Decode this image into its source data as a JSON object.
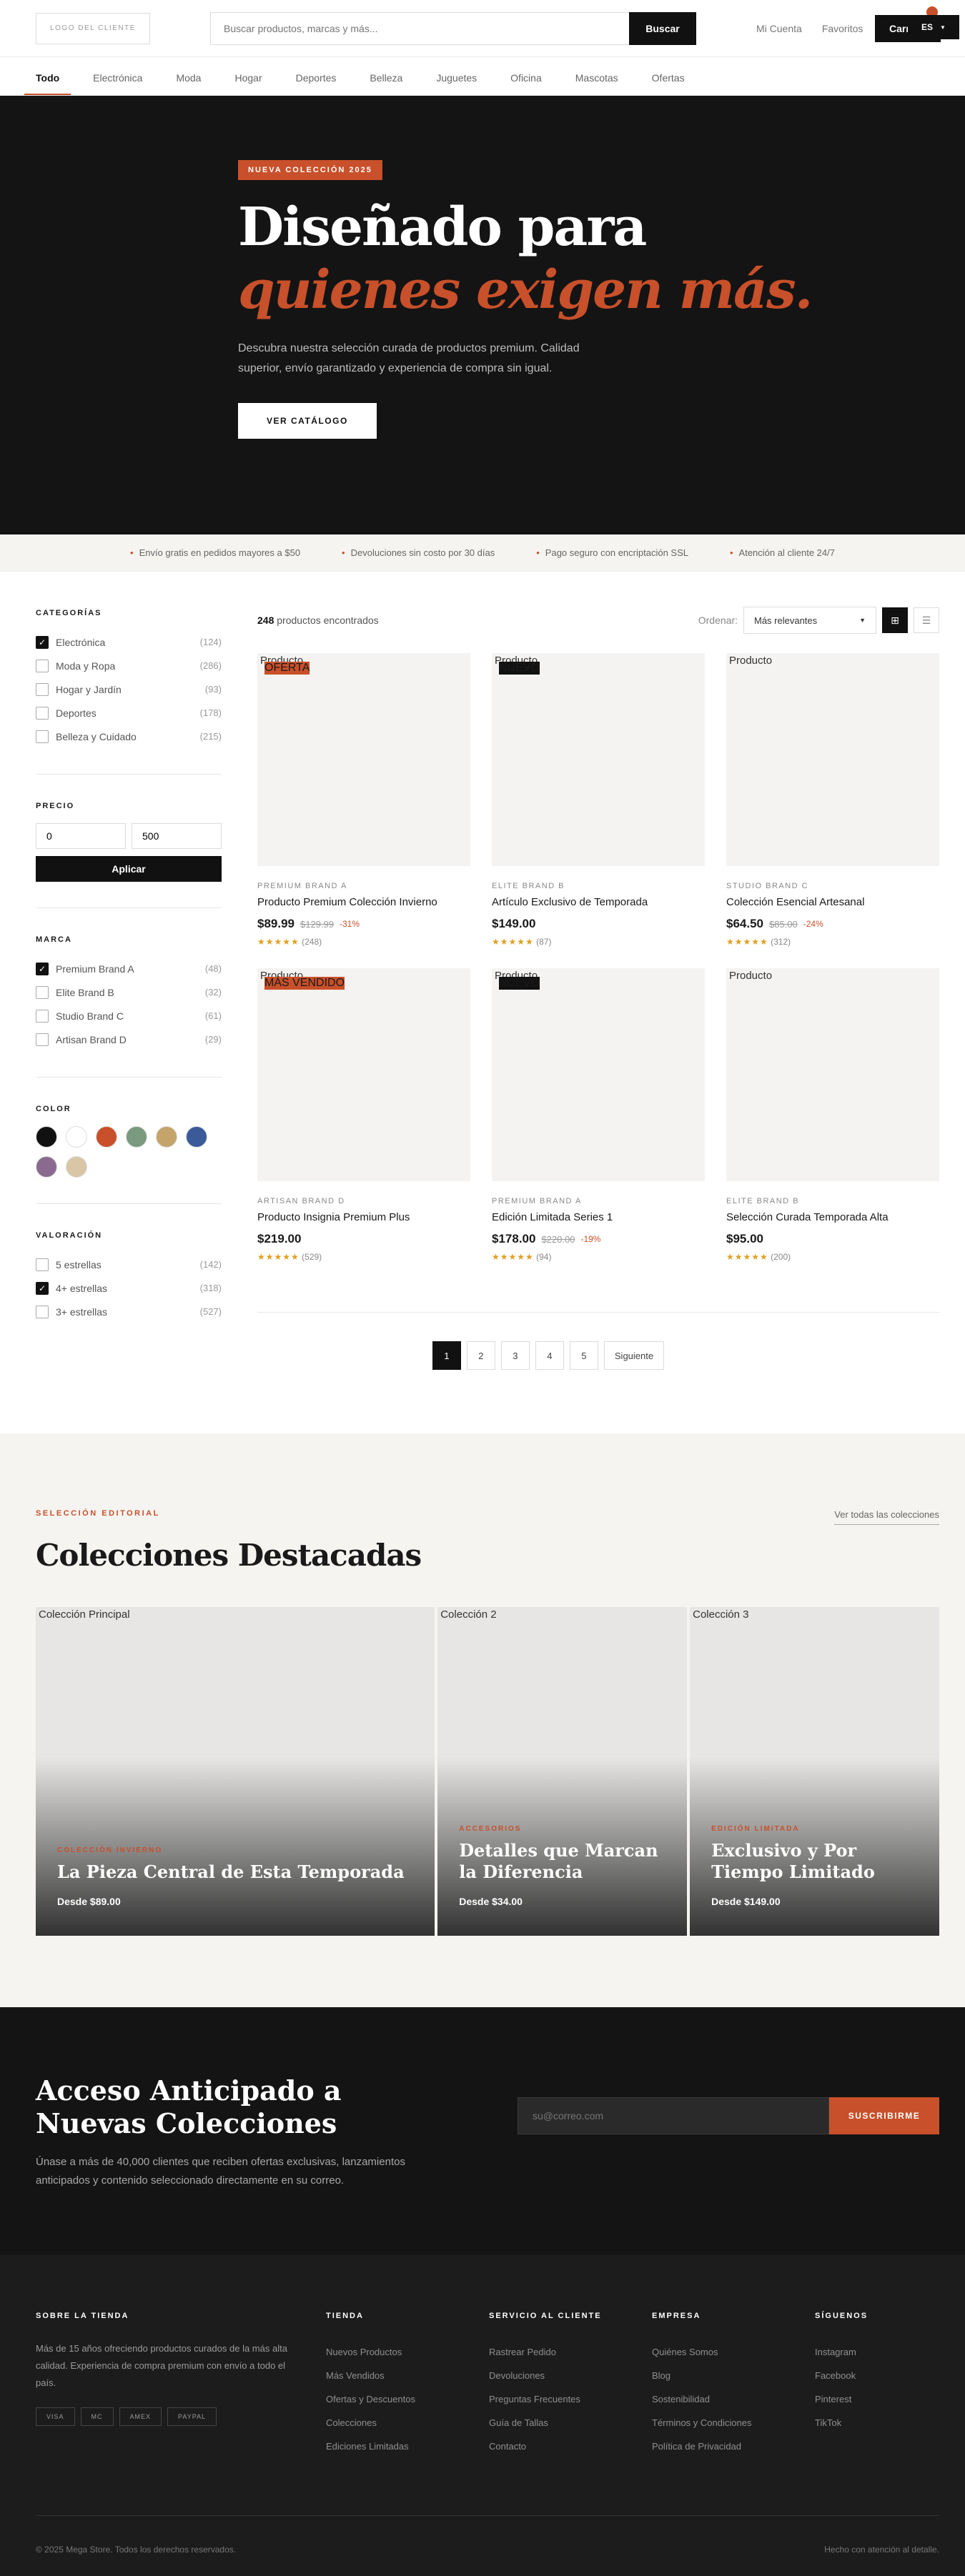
{
  "header": {
    "logo": "LOGO DEL CLIENTE",
    "search_placeholder": "Buscar productos, marcas y más...",
    "search_button": "Buscar",
    "account": "Mi Cuenta",
    "favorites": "Favoritos",
    "cart": "Carrito",
    "lang": "ES"
  },
  "nav": [
    "Todo",
    "Electrónica",
    "Moda",
    "Hogar",
    "Deportes",
    "Belleza",
    "Juguetes",
    "Oficina",
    "Mascotas",
    "Ofertas"
  ],
  "hero": {
    "badge": "NUEVA COLECCIÓN 2025",
    "title_1": "Diseñado para",
    "title_2": "quienes exigen más.",
    "desc": "Descubra nuestra selección curada de productos premium. Calidad superior, envío garantizado y experiencia de compra sin igual.",
    "cta": "VER CATÁLOGO"
  },
  "benefits": [
    "Envío gratis en pedidos mayores a $50",
    "Devoluciones sin costo por 30 días",
    "Pago seguro con encriptación SSL",
    "Atención al cliente 24/7"
  ],
  "filters": {
    "categories_title": "CATEGORÍAS",
    "categories": [
      {
        "label": "Electrónica",
        "count": "(124)",
        "checked": true
      },
      {
        "label": "Moda y Ropa",
        "count": "(286)",
        "checked": false
      },
      {
        "label": "Hogar y Jardín",
        "count": "(93)",
        "checked": false
      },
      {
        "label": "Deportes",
        "count": "(178)",
        "checked": false
      },
      {
        "label": "Belleza y Cuidado",
        "count": "(215)",
        "checked": false
      }
    ],
    "price_title": "PRECIO",
    "price_min": "0",
    "price_max": "500",
    "apply": "Aplicar",
    "brand_title": "MARCA",
    "brands": [
      {
        "label": "Premium Brand A",
        "count": "(48)",
        "checked": true
      },
      {
        "label": "Elite Brand B",
        "count": "(32)",
        "checked": false
      },
      {
        "label": "Studio Brand C",
        "count": "(61)",
        "checked": false
      },
      {
        "label": "Artisan Brand D",
        "count": "(29)",
        "checked": false
      }
    ],
    "color_title": "COLOR",
    "colors": [
      "#111111",
      "#ffffff",
      "#c8502a",
      "#7a9a80",
      "#c4a46a",
      "#3a5a9a",
      "#8a6a8e",
      "#d8c6a6"
    ],
    "rating_title": "VALORACIÓN",
    "ratings": [
      {
        "label": "5 estrellas",
        "count": "(142)",
        "checked": false
      },
      {
        "label": "4+ estrellas",
        "count": "(318)",
        "checked": true
      },
      {
        "label": "3+ estrellas",
        "count": "(527)",
        "checked": false
      }
    ]
  },
  "toolbar": {
    "count": "248",
    "count_label": " productos encontrados",
    "sort_label": "Ordenar:",
    "sort_value": "Más relevantes"
  },
  "products": [
    {
      "img_alt": "Producto",
      "tag": "OFERTA",
      "tag_color": "#c8502a",
      "brand": "PREMIUM BRAND A",
      "name": "Producto Premium Colección Invierno",
      "price": "$89.99",
      "old": "$129.99",
      "off": "-31%",
      "stars": "★★★★★",
      "reviews": "(248)"
    },
    {
      "img_alt": "Producto",
      "tag": "NUEVO",
      "tag_color": "#111111",
      "brand": "ELITE BRAND B",
      "name": "Artículo Exclusivo de Temporada",
      "price": "$149.00",
      "old": "",
      "off": "",
      "stars": "★★★★★",
      "reviews": "(87)"
    },
    {
      "img_alt": "Producto",
      "tag": "",
      "tag_color": "",
      "brand": "STUDIO BRAND C",
      "name": "Colección Esencial Artesanal",
      "price": "$64.50",
      "old": "$85.00",
      "off": "-24%",
      "stars": "★★★★★",
      "reviews": "(312)"
    },
    {
      "img_alt": "Producto",
      "tag": "MÁS VENDIDO",
      "tag_color": "#c8502a",
      "brand": "ARTISAN BRAND D",
      "name": "Producto Insignia Premium Plus",
      "price": "$219.00",
      "old": "",
      "off": "",
      "stars": "★★★★★",
      "reviews": "(529)"
    },
    {
      "img_alt": "Producto",
      "tag": "NUEVO",
      "tag_color": "#111111",
      "brand": "PREMIUM BRAND A",
      "name": "Edición Limitada Series 1",
      "price": "$178.00",
      "old": "$220.00",
      "off": "-19%",
      "stars": "★★★★★",
      "reviews": "(94)"
    },
    {
      "img_alt": "Producto",
      "tag": "",
      "tag_color": "",
      "brand": "ELITE BRAND B",
      "name": "Selección Curada Temporada Alta",
      "price": "$95.00",
      "old": "",
      "off": "",
      "stars": "★★★★★",
      "reviews": "(200)"
    }
  ],
  "pagination": [
    "1",
    "2",
    "3",
    "4",
    "5",
    "Siguiente"
  ],
  "collections": {
    "eyebrow": "SELECCIÓN EDITORIAL",
    "title": "Colecciones Destacadas",
    "link": "Ver todas las colecciones",
    "items": [
      {
        "img_alt": "Colección Principal",
        "eyebrow": "COLECCIÓN INVIERNO",
        "title": "La Pieza Central de Esta Temporada",
        "price": "Desde $89.00"
      },
      {
        "img_alt": "Colección 2",
        "eyebrow": "ACCESORIOS",
        "title": "Detalles que Marcan la Diferencia",
        "price": "Desde $34.00"
      },
      {
        "img_alt": "Colección 3",
        "eyebrow": "EDICIÓN LIMITADA",
        "title": "Exclusivo y Por Tiempo Limitado",
        "price": "Desde $149.00"
      }
    ]
  },
  "newsletter": {
    "title": "Acceso Anticipado a Nuevas Colecciones",
    "desc": "Únase a más de 40,000 clientes que reciben ofertas exclusivas, lanzamientos anticipados y contenido seleccionado directamente en su correo.",
    "placeholder": "su@correo.com",
    "button": "SUSCRIBIRME"
  },
  "footer": {
    "about_title": "SOBRE LA TIENDA",
    "about": "Más de 15 años ofreciendo productos curados de la más alta calidad. Experiencia de compra premium con envío a todo el país.",
    "payments": [
      "VISA",
      "MC",
      "AMEX",
      "PAYPAL"
    ],
    "cols": [
      {
        "title": "TIENDA",
        "links": [
          "Nuevos Productos",
          "Más Vendidos",
          "Ofertas y Descuentos",
          "Colecciones",
          "Ediciones Limitadas"
        ]
      },
      {
        "title": "SERVICIO AL CLIENTE",
        "links": [
          "Rastrear Pedido",
          "Devoluciones",
          "Preguntas Frecuentes",
          "Guía de Tallas",
          "Contacto"
        ]
      },
      {
        "title": "EMPRESA",
        "links": [
          "Quiénes Somos",
          "Blog",
          "Sostenibilidad",
          "Términos y Condiciones",
          "Política de Privacidad"
        ]
      },
      {
        "title": "SÍGUENOS",
        "links": [
          "Instagram",
          "Facebook",
          "Pinterest",
          "TikTok"
        ]
      }
    ],
    "copyright": "© 2025 Mega Store. Todos los derechos reservados.",
    "tagline": "Hecho con atención al detalle."
  }
}
